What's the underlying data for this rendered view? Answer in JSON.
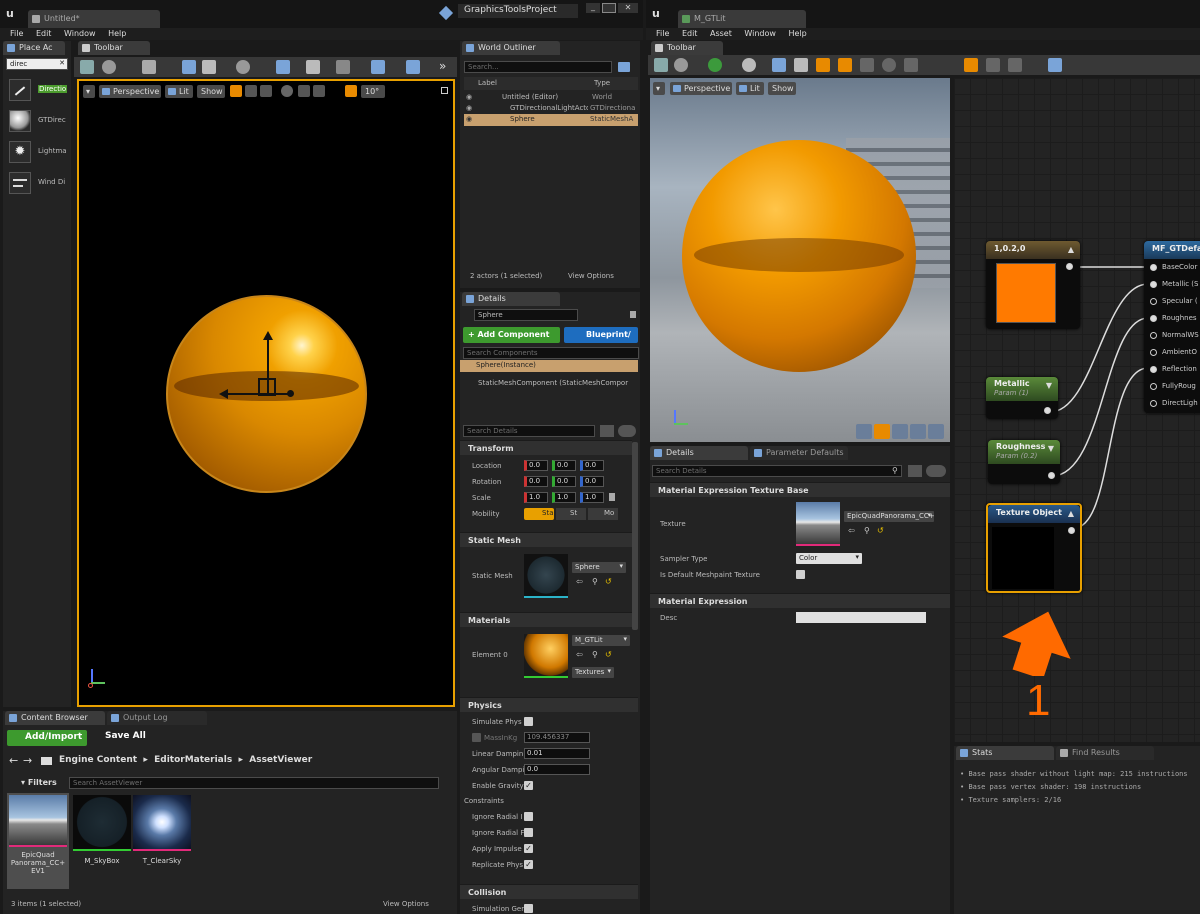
{
  "left_window": {
    "doc_tab": "Untitled*",
    "project_title": "GraphicsToolsProject",
    "menu": [
      "File",
      "Edit",
      "Window",
      "Help"
    ],
    "place_actors": {
      "tab": "Place Ac",
      "search": "direc",
      "items": [
        {
          "label": "Directio",
          "highlight": "Directio",
          "icon": "light-icon"
        },
        {
          "label": "GTDirec",
          "highlight": "Direc",
          "icon": "sphere-icon"
        },
        {
          "label": "Lightma",
          "highlight": "",
          "icon": "lightmass-icon"
        },
        {
          "label": "Wind Di",
          "highlight": "Di",
          "icon": "wind-icon"
        }
      ]
    },
    "toolbar_tab": "Toolbar",
    "viewport": {
      "perspective": "Perspective",
      "lit": "Lit",
      "show": "Show",
      "angle": "10°"
    },
    "outliner": {
      "tab": "World Outliner",
      "search_placeholder": "Search...",
      "col_label": "Label",
      "col_type": "Type",
      "rows": [
        {
          "label": "Untitled (Editor)",
          "type": "World"
        },
        {
          "label": "GTDirectionalLightActor",
          "type": "GTDirectiona"
        },
        {
          "label": "Sphere",
          "type": "StaticMeshA"
        }
      ],
      "footer": "2 actors (1 selected)",
      "view_options": "View Options"
    },
    "details": {
      "tab": "Details",
      "object_name": "Sphere",
      "add_component": "+ Add Component",
      "blueprint": "Blueprint/",
      "search_components": "Search Components",
      "instance": "Sphere(Instance)",
      "component": "StaticMeshComponent (StaticMeshCompor",
      "search_details": "Search Details",
      "transform": {
        "title": "Transform",
        "location": "Location",
        "rotation": "Rotation",
        "scale": "Scale",
        "mobility": "Mobility",
        "loc": [
          "0.0",
          "0.0",
          "0.0"
        ],
        "rot": [
          "0.0",
          "0.0",
          "0.0"
        ],
        "scl": [
          "1.0",
          "1.0",
          "1.0"
        ],
        "mob": [
          "Sta",
          "St",
          "Mo"
        ]
      },
      "static_mesh": {
        "title": "Static Mesh",
        "label": "Static Mesh",
        "value": "Sphere"
      },
      "materials": {
        "title": "Materials",
        "label": "Element 0",
        "value": "M_GTLit",
        "textures": "Textures"
      },
      "physics": {
        "title": "Physics",
        "simulate": "Simulate Phys",
        "mass_label": "MassInKg",
        "mass": "109.456337",
        "linear_label": "Linear Dampin",
        "linear": "0.01",
        "angular_label": "Angular Dampi",
        "angular": "0.0",
        "gravity": "Enable Gravity",
        "constraints": "Constraints",
        "ignore1": "Ignore Radial I",
        "ignore2": "Ignore Radial F",
        "impulse": "Apply Impulse",
        "replicate": "Replicate Phys"
      },
      "collision": {
        "title": "Collision",
        "sim": "Simulation Ger"
      }
    },
    "content_browser": {
      "tab": "Content Browser",
      "tab2": "Output Log",
      "add_import": "Add/Import",
      "save_all": "Save All",
      "crumbs": [
        "Engine Content",
        "EditorMaterials",
        "AssetViewer"
      ],
      "filters": "Filters",
      "search": "Search AssetViewer",
      "assets": [
        "EpicQuad Panorama_CC+ EV1",
        "M_SkyBox",
        "T_ClearSky"
      ],
      "footer": "3 items (1 selected)",
      "view_options": "View Options"
    }
  },
  "right_window": {
    "doc_tab": "M_GTLit",
    "menu": [
      "File",
      "Edit",
      "Asset",
      "Window",
      "Help"
    ],
    "toolbar_tab": "Toolbar",
    "viewport": {
      "perspective": "Perspective",
      "lit": "Lit",
      "show": "Show"
    },
    "details": {
      "tab": "Details",
      "tab2": "Parameter Defaults",
      "search": "Search Details",
      "section1": "Material Expression Texture Base",
      "texture_label": "Texture",
      "texture_value": "EpicQuadPanorama_CC+",
      "sampler_label": "Sampler Type",
      "sampler_value": "Color",
      "meshpaint_label": "Is Default Meshpaint Texture",
      "section2": "Material Expression",
      "desc_label": "Desc"
    },
    "graph": {
      "const_node": {
        "title": "1,0.2,0",
        "color": "#ff7a00"
      },
      "metallic_node": {
        "title": "Metallic",
        "sub": "Param (1)"
      },
      "roughness_node": {
        "title": "Roughness",
        "sub": "Param (0.2)"
      },
      "texture_node": {
        "title": "Texture Object"
      },
      "mf_node": {
        "title": "MF_GTDefau",
        "pins": [
          "BaseColor",
          "Metallic (S",
          "Specular (",
          "Roughnes",
          "NormalWS",
          "AmbientO",
          "Reflection",
          "FullyRoug",
          "DirectLigh"
        ]
      },
      "annotation": "1"
    },
    "stats": {
      "tab": "Stats",
      "tab2": "Find Results",
      "lines": [
        "Base pass shader without light map: 215 instructions",
        "Base pass vertex shader: 198 instructions",
        "Texture samplers: 2/16"
      ]
    }
  },
  "colors": {
    "orange_sphere": "#e88a00",
    "accent_orange": "#ff6a00",
    "node_green": "#4d7a2e",
    "node_blue": "#2e4d7a"
  }
}
